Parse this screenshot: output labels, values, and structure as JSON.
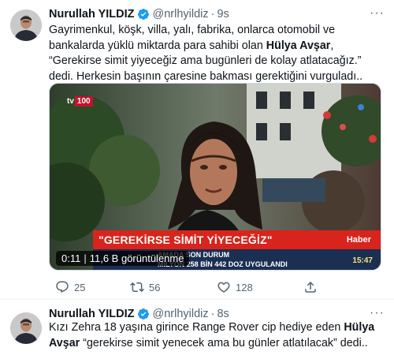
{
  "tweets": [
    {
      "author": {
        "name": "Nurullah YILDIZ",
        "handle": "@nrlhyildiz",
        "separator": "·",
        "time": "9s",
        "verified": true
      },
      "text_parts": [
        "Gayrimenkul, köşk, villa, yalı, fabrika, onlarca otomobil ve bankalarda yüklü miktarda para sahibi olan ",
        "Hülya Avşar",
        ", “Gerekirse simit yiyeceğiz ama bugünleri de kolay atlatacağız.” dedi. Herkesin başının çaresine bakması gerektiğini vurguladı.."
      ],
      "media": {
        "channel": "tv",
        "channel_box": "100",
        "banner_title": "\"GEREKİRSE SİMİT YİYECEĞİZ\"",
        "banner_brand": "Haber",
        "ticker_line1": "AMADA SON DURUM",
        "ticker_line2": "MİLYON 258 BİN 442 DOZ UYGULANDI",
        "clock": "15:47",
        "duration": "0:11",
        "separator": "|",
        "views": "11,6 B görüntülenme"
      },
      "actions": {
        "replies": "25",
        "retweets": "56",
        "likes": "128"
      },
      "more": "···"
    },
    {
      "author": {
        "name": "Nurullah YILDIZ",
        "handle": "@nrlhyildiz",
        "separator": "·",
        "time": "8s",
        "verified": true
      },
      "text_parts": [
        "Kızı Zehra 18 yaşına girince Range Rover cip hediye eden ",
        "Hülya Avşar",
        " “gerekirse simit yenecek ama bu günler atlatılacak” dedi.."
      ],
      "more": "···"
    }
  ],
  "icons": {
    "verified": "verified-badge-icon",
    "reply": "reply-icon",
    "retweet": "retweet-icon",
    "like": "heart-icon",
    "share": "share-icon",
    "more": "more-icon"
  },
  "colors": {
    "verified_blue": "#1d9bf0",
    "secondary_text": "#536471",
    "banner_red": "#d8241c",
    "ticker_navy": "#1b2f52"
  }
}
